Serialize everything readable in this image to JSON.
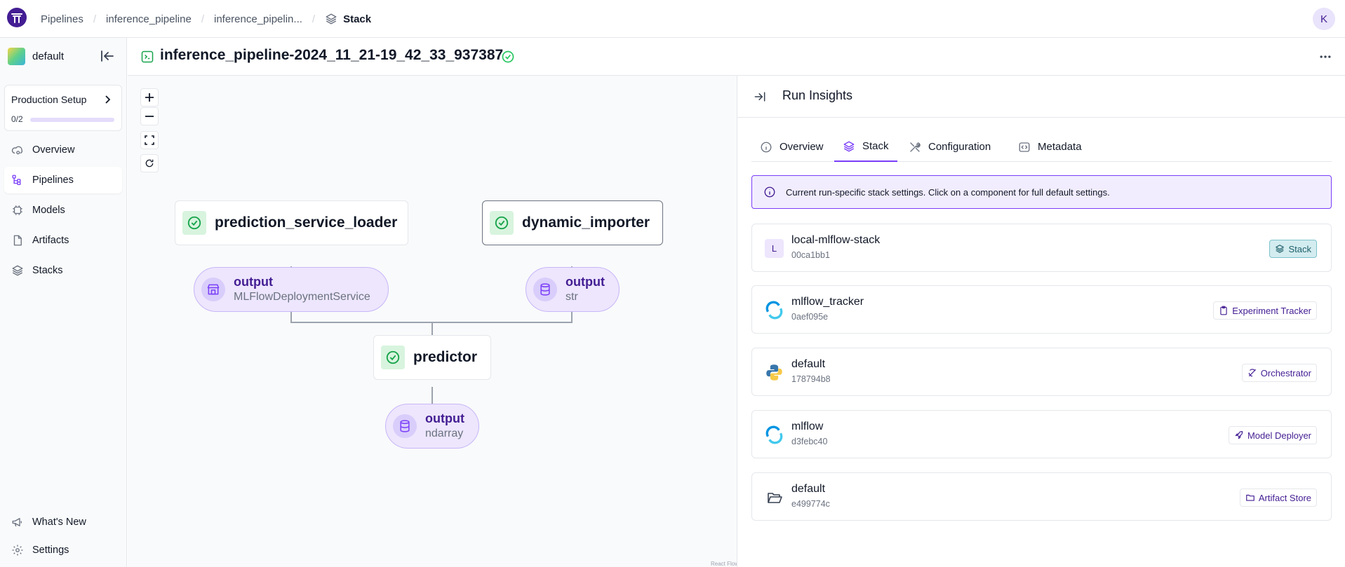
{
  "breadcrumbs": [
    "Pipelines",
    "inference_pipeline",
    "inference_pipelin...",
    "Stack"
  ],
  "user": {
    "initial": "K"
  },
  "sidebar": {
    "workspace": "default",
    "production_setup": {
      "title": "Production Setup",
      "count": "0/2",
      "progress": 0
    },
    "nav": [
      {
        "label": "Overview",
        "icon": "cloud-gear-icon"
      },
      {
        "label": "Pipelines",
        "icon": "pipeline-icon",
        "active": true
      },
      {
        "label": "Models",
        "icon": "chip-icon"
      },
      {
        "label": "Artifacts",
        "icon": "file-icon"
      },
      {
        "label": "Stacks",
        "icon": "layers-icon"
      }
    ],
    "bottom": [
      {
        "label": "What's New",
        "icon": "megaphone-icon"
      },
      {
        "label": "Settings",
        "icon": "gear-icon"
      }
    ]
  },
  "run": {
    "title": "inference_pipeline-2024_11_21-19_42_33_937387",
    "status": "completed"
  },
  "dag": {
    "steps": {
      "loader": "prediction_service_loader",
      "importer": "dynamic_importer",
      "predictor": "predictor"
    },
    "artifacts": {
      "loader_out": {
        "name": "output",
        "type": "MLFlowDeploymentService"
      },
      "importer_out": {
        "name": "output",
        "type": "str"
      },
      "predictor_out": {
        "name": "output",
        "type": "ndarray"
      }
    },
    "attribution": "React Flow"
  },
  "panel": {
    "title": "Run Insights",
    "tabs": [
      {
        "label": "Overview",
        "icon": "info-icon"
      },
      {
        "label": "Stack",
        "icon": "layers-icon",
        "active": true
      },
      {
        "label": "Configuration",
        "icon": "tools-icon"
      },
      {
        "label": "Metadata",
        "icon": "code-icon"
      }
    ],
    "info": "Current run-specific stack settings. Click on a component for full default settings.",
    "components": [
      {
        "name": "local-mlflow-stack",
        "id": "00ca1bb1",
        "letter": "L",
        "badge": "Stack",
        "icon": "letter-avatar"
      },
      {
        "name": "mlflow_tracker",
        "id": "0aef095e",
        "badge": "Experiment Tracker",
        "icon": "mlflow-icon"
      },
      {
        "name": "default",
        "id": "178794b8",
        "badge": "Orchestrator",
        "icon": "python-icon"
      },
      {
        "name": "mlflow",
        "id": "d3febc40",
        "badge": "Model Deployer",
        "icon": "mlflow-icon"
      },
      {
        "name": "default",
        "id": "e499774c",
        "badge": "Artifact Store",
        "icon": "folder-icon"
      }
    ]
  },
  "colors": {
    "accent": "#7a3ef8",
    "brand": "#431d93",
    "success": "#22c55e",
    "artifact_bg": "#ede6fd"
  }
}
